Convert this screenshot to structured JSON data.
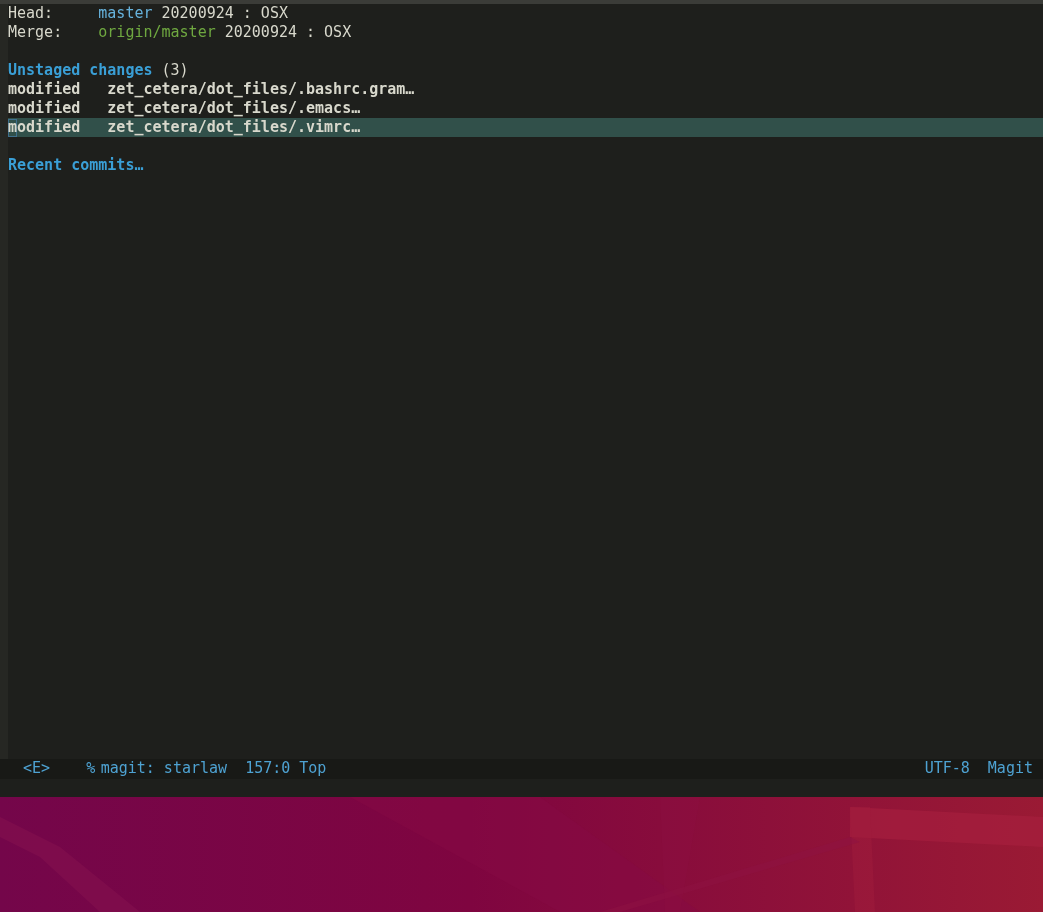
{
  "header": [
    {
      "label": "Head:",
      "ref": "master",
      "kind": "local",
      "info": "20200924 : OSX"
    },
    {
      "label": "Merge:",
      "ref": "origin/master",
      "kind": "remote",
      "info": "20200924 : OSX"
    }
  ],
  "sections": [
    {
      "title": "Unstaged changes",
      "count": "(3)",
      "items": [
        {
          "status": "modified",
          "path": "zet_cetera/dot_files/.bashrc.gram…",
          "selected": false
        },
        {
          "status": "modified",
          "path": "zet_cetera/dot_files/.emacs…",
          "selected": false
        },
        {
          "status": "modified",
          "path": "zet_cetera/dot_files/.vimrc…",
          "selected": true
        }
      ]
    },
    {
      "title": "Recent commits…"
    }
  ],
  "mode_line": {
    "state": "<E>",
    "modified_flag": "%",
    "buffer": "magit: starlaw",
    "position": "157:0",
    "scroll": "Top",
    "encoding": "UTF-8",
    "mode": "Magit"
  }
}
